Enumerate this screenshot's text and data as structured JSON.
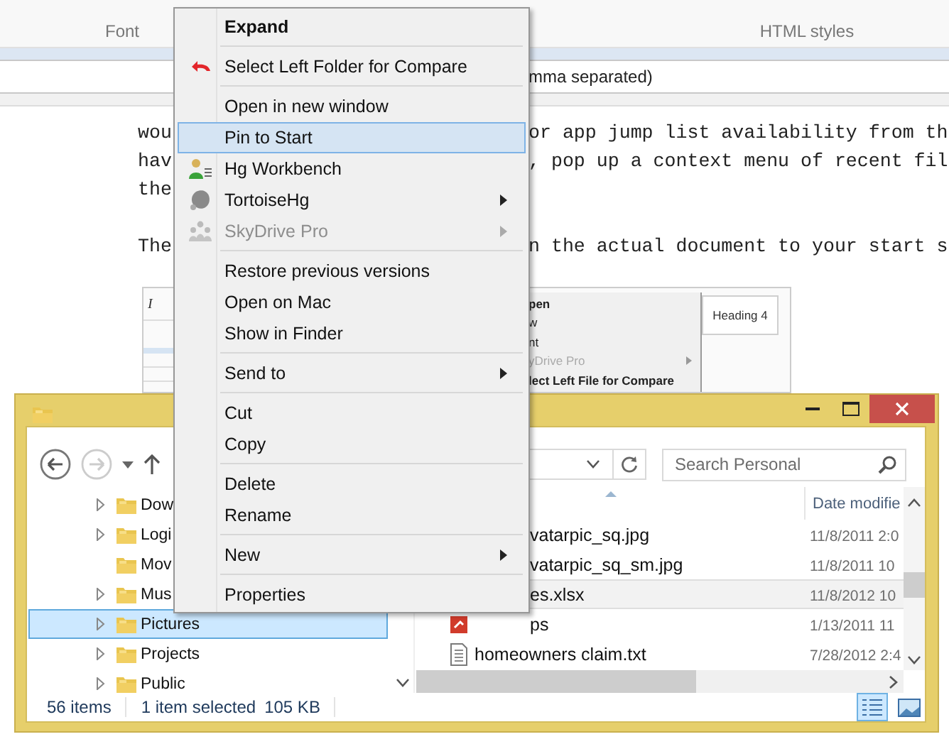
{
  "document": {
    "ribbon_groups": [
      {
        "label": "Font"
      },
      {
        "label": "HTML styles"
      }
    ],
    "field": {
      "value": "mma separated)"
    },
    "paragraphs": [
      {
        "lines": [
          {
            "start": "wou",
            "end": "or app jump list availability from th"
          },
          {
            "start": "hav",
            "end": ", pop up a context menu of recent fil"
          },
          {
            "start": "the"
          }
        ]
      },
      {
        "lines": [
          {
            "start": "The",
            "end": "n the actual document to your start s"
          }
        ]
      }
    ],
    "embedded_screenshot": {
      "format_buttons": [
        "I"
      ],
      "menu_items": [
        {
          "label": "pen",
          "bold": true,
          "disabled": false,
          "submenu": false
        },
        {
          "label": "w",
          "bold": false,
          "disabled": false,
          "submenu": false
        },
        {
          "label": "nt",
          "bold": false,
          "disabled": false,
          "submenu": false
        },
        {
          "label": "yDrive Pro",
          "bold": false,
          "disabled": true,
          "submenu": true
        },
        {
          "label": "lect Left File for Compare",
          "bold": true,
          "disabled": false,
          "submenu": false
        }
      ],
      "style_label": "Heading 4"
    }
  },
  "explorer": {
    "search": {
      "placeholder": "Search Personal"
    },
    "tree": [
      {
        "label": "Dow",
        "expandable": true,
        "selected": false
      },
      {
        "label": "Logi",
        "expandable": true,
        "selected": false
      },
      {
        "label": "Mov",
        "expandable": false,
        "selected": false
      },
      {
        "label": "Mus",
        "expandable": true,
        "selected": false
      },
      {
        "label": "Pictures",
        "expandable": true,
        "selected": true
      },
      {
        "label": "Projects",
        "expandable": true,
        "selected": false
      },
      {
        "label": "Public",
        "expandable": true,
        "selected": false
      }
    ],
    "date_header": "Date modifie",
    "files": [
      {
        "kind": "partial",
        "name": "vatarpic_sq.jpg",
        "date": "11/8/2011 2:0",
        "selected": false
      },
      {
        "kind": "partial",
        "name": "vatarpic_sq_sm.jpg",
        "date": "11/8/2011 10",
        "selected": false
      },
      {
        "kind": "partial",
        "name": "es.xlsx",
        "date": "11/8/2012 10",
        "selected": true
      },
      {
        "kind": "partial",
        "name": "ps",
        "date": "1/13/2011 11",
        "selected": false
      },
      {
        "kind": "file",
        "name": "homeowners claim.txt",
        "date": "7/28/2012 2:4",
        "selected": false
      }
    ],
    "status_sections": [
      [
        "56 items"
      ],
      [
        "1 item selected",
        "105 KB"
      ]
    ]
  },
  "context_menu": {
    "items": [
      {
        "kind": "item",
        "label": "Expand",
        "bold": true,
        "selected": false,
        "disabled": false,
        "submenu": false
      },
      {
        "kind": "separator"
      },
      {
        "kind": "item",
        "label": "Select Left Folder for Compare",
        "bold": false,
        "selected": false,
        "disabled": false,
        "submenu": false
      },
      {
        "kind": "separator"
      },
      {
        "kind": "item",
        "label": "Open in new window",
        "bold": false,
        "selected": false,
        "disabled": false,
        "submenu": false
      },
      {
        "kind": "item",
        "label": "Pin to Start",
        "bold": false,
        "selected": true,
        "disabled": false,
        "submenu": false
      },
      {
        "kind": "item",
        "label": "Hg Workbench",
        "bold": false,
        "selected": false,
        "disabled": false,
        "submenu": false
      },
      {
        "kind": "item",
        "label": "TortoiseHg",
        "bold": false,
        "selected": false,
        "disabled": false,
        "submenu": true
      },
      {
        "kind": "item",
        "label": "SkyDrive Pro",
        "bold": false,
        "selected": false,
        "disabled": true,
        "submenu": true
      },
      {
        "kind": "separator"
      },
      {
        "kind": "item",
        "label": "Restore previous versions",
        "bold": false,
        "selected": false,
        "disabled": false,
        "submenu": false
      },
      {
        "kind": "item",
        "label": "Open on Mac",
        "bold": false,
        "selected": false,
        "disabled": false,
        "submenu": false
      },
      {
        "kind": "item",
        "label": "Show in Finder",
        "bold": false,
        "selected": false,
        "disabled": false,
        "submenu": false
      },
      {
        "kind": "separator"
      },
      {
        "kind": "item",
        "label": "Send to",
        "bold": false,
        "selected": false,
        "disabled": false,
        "submenu": true
      },
      {
        "kind": "separator"
      },
      {
        "kind": "item",
        "label": "Cut",
        "bold": false,
        "selected": false,
        "disabled": false,
        "submenu": false
      },
      {
        "kind": "item",
        "label": "Copy",
        "bold": false,
        "selected": false,
        "disabled": false,
        "submenu": false
      },
      {
        "kind": "separator"
      },
      {
        "kind": "item",
        "label": "Delete",
        "bold": false,
        "selected": false,
        "disabled": false,
        "submenu": false
      },
      {
        "kind": "item",
        "label": "Rename",
        "bold": false,
        "selected": false,
        "disabled": false,
        "submenu": false
      },
      {
        "kind": "separator"
      },
      {
        "kind": "item",
        "label": "New",
        "bold": false,
        "selected": false,
        "disabled": false,
        "submenu": true
      },
      {
        "kind": "separator"
      },
      {
        "kind": "item",
        "label": "Properties",
        "bold": false,
        "selected": false,
        "disabled": false,
        "submenu": false
      }
    ]
  }
}
